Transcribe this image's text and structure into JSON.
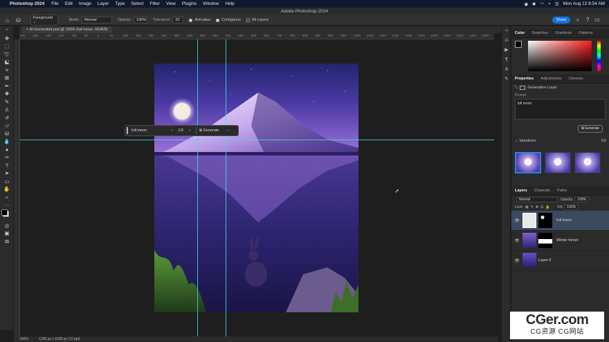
{
  "menubar": {
    "app_name": "Photoshop 2024",
    "items": [
      "File",
      "Edit",
      "Image",
      "Layer",
      "Type",
      "Select",
      "Filter",
      "View",
      "Plugins",
      "Window",
      "Help"
    ],
    "datetime": "Mon Aug 12  8:54 AM"
  },
  "window": {
    "title": "Adobe Photoshop 2024"
  },
  "options": {
    "sample": "Foreground",
    "mode_label": "Mode:",
    "mode_value": "Normal",
    "opacity_label": "Opacity:",
    "opacity_value": "100%",
    "tolerance_label": "Tolerance:",
    "tolerance_value": "32",
    "antialias_label": "Anti-alias",
    "contiguous_label": "Contiguous",
    "all_layers_label": "All Layers",
    "share_label": "Share"
  },
  "document": {
    "tab_title": "AI-Generated.psd @ 100% (full moon, RGB/8)",
    "zoom": "100%",
    "info": "1200 px x 1630 px (72 ppi)"
  },
  "ruler": {
    "top_ticks": [
      "300",
      "250",
      "200",
      "150",
      "100",
      "50",
      "0",
      "50",
      "100",
      "150",
      "200",
      "250",
      "300",
      "350",
      "400",
      "450",
      "500",
      "550",
      "600",
      "650",
      "700",
      "750",
      "800",
      "850",
      "900",
      "950",
      "1000",
      "1050",
      "1100",
      "1150",
      "1200",
      "1250",
      "1300",
      "1350",
      "1400",
      "1450",
      "1500"
    ]
  },
  "generative_bar": {
    "prompt": "full moon",
    "counter": "1/3",
    "generate_label": "Generate",
    "more_label": "···"
  },
  "color_panel": {
    "tabs": [
      "Color",
      "Swatches",
      "Gradients",
      "Patterns"
    ],
    "foreground": "#000000",
    "background": "#ffffff",
    "hue": "#ff1a1a"
  },
  "properties_panel": {
    "tabs": [
      "Properties",
      "Adjustments",
      "Libraries"
    ],
    "layer_type": "Generative Layer",
    "prompt_label": "Prompt",
    "prompt_value": "full moon",
    "generate_label": "Generate",
    "variations_label": "Variations",
    "variations_count": "1/3"
  },
  "layers_panel": {
    "tabs": [
      "Layers",
      "Channels",
      "Paths"
    ],
    "blend_mode": "Normal",
    "opacity_label": "Opacity:",
    "opacity_value": "100%",
    "lock_label": "Lock:",
    "fill_label": "Fill:",
    "fill_value": "100%",
    "layers": [
      {
        "name": "full moon",
        "selected": true
      },
      {
        "name": "Winter forest",
        "selected": false
      },
      {
        "name": "Layer 0",
        "selected": false
      }
    ]
  },
  "watermark": {
    "main": "CGer.com",
    "sub": "CG资源 CG网站"
  },
  "colors": {
    "guide": "#46d8e0",
    "accent": "#1473e6",
    "selection": "#3b4a5e"
  }
}
